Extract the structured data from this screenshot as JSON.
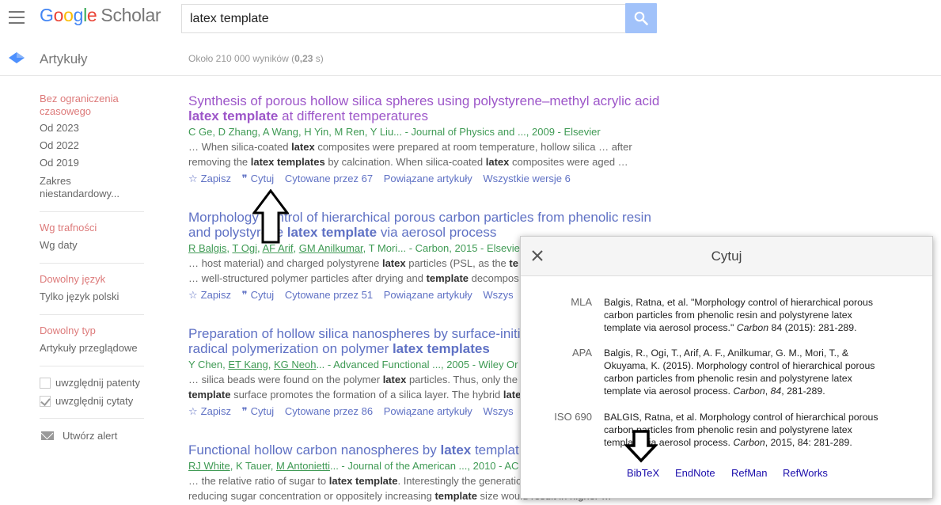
{
  "header": {
    "logo_google": "Google",
    "logo_scholar": "Scholar",
    "search_value": "latex template"
  },
  "subheader": {
    "section_label": "Artykuły",
    "stats_prefix": "Około 210 000 wyników (",
    "stats_time": "0,23",
    "stats_suffix": " s)"
  },
  "sidebar": {
    "time_any": "Bez ograniczenia czasowego",
    "since_2023": "Od 2023",
    "since_2022": "Od 2022",
    "since_2019": "Od 2019",
    "custom_range": "Zakres niestandardowy...",
    "sort_relevance": "Wg trafności",
    "sort_date": "Wg daty",
    "lang_any": "Dowolny język",
    "lang_polish": "Tylko język polski",
    "type_any": "Dowolny typ",
    "type_review": "Artykuły przeglądowe",
    "include_patents": "uwzględnij patenty",
    "include_citations": "uwzględnij cytaty",
    "create_alert": "Utwórz alert"
  },
  "results": [
    {
      "title_a": "Synthesis of porous hollow silica spheres using polystyrene–methyl acrylic acid",
      "title_b": "latex template",
      "title_c": " at different temperatures",
      "authors": "C Ge, D Zhang, A Wang, H Yin, M Ren, Y Liu... - Journal of Physics and ..., 2009 - Elsevier",
      "snippet1": "… When silica-coated latex composites were prepared at room temperature, hollow silica … after",
      "snippet2": "removing the latex templates by calcination. When silica-coated latex composites were aged …",
      "save": "Zapisz",
      "cite": "Cytuj",
      "cited_by": "Cytowane przez 67",
      "related": "Powiązane artykuły",
      "versions": "Wszystkie wersje 6"
    },
    {
      "title_a": "Morphology control of hierarchical porous carbon particles from phenolic resin",
      "title_b": "and polystyrene latex template via aerosol process",
      "authors": "R Balgis, T Ogi, AF Arif, GM Anilkumar, T Mori... - Carbon, 2015 - Elsevier",
      "snippet1": "… host material) and charged polystyrene latex particles (PSL, as the te",
      "snippet2": "… well-structured polymer particles after drying and template decompos",
      "save": "Zapisz",
      "cite": "Cytuj",
      "cited_by": "Cytowane przez 51",
      "related": "Powiązane artykuły",
      "versions": "Wszys"
    },
    {
      "title_a": "Preparation of hollow silica nanospheres by surface-initi",
      "title_b": "radical polymerization on polymer latex templates",
      "authors": "Y Chen, ET Kang, KG Neoh... - Advanced Functional ..., 2005 - Wiley Or",
      "snippet1": "… silica beads were found on the polymer latex particles. Thus, only the",
      "snippet2": "template surface promotes the formation of a silica layer. The hybrid late",
      "save": "Zapisz",
      "cite": "Cytuj",
      "cited_by": "Cytowane przez 86",
      "related": "Powiązane artykuły",
      "versions": "Wszys"
    },
    {
      "title_a": "Functional hollow carbon nanospheres by latex templat",
      "authors": "RJ White, K Tauer, M Antonietti... - Journal of the American ..., 2010 - AC",
      "snippet1": "… the relative ratio of sugar to latex template. Interestingly the generatio",
      "snippet2": "reducing sugar concentration or oppositely increasing template size would result in higher …"
    }
  ],
  "cite_dialog": {
    "title": "Cytuj",
    "styles": [
      {
        "name": "MLA"
      },
      {
        "name": "APA"
      },
      {
        "name": "ISO 690"
      }
    ],
    "mla_line1": "Balgis, Ratna, et al. \"Morphology control of hierarchical porous",
    "mla_line2": "carbon particles from phenolic resin and polystyrene latex",
    "mla_line3a": "template via aerosol process.\" ",
    "mla_journal": "Carbon",
    "mla_line3b": " 84 (2015): 281-289.",
    "apa_line1": "Balgis, R., Ogi, T., Arif, A. F., Anilkumar, G. M., Mori, T., &",
    "apa_line2": "Okuyama, K. (2015). Morphology control of hierarchical porous",
    "apa_line3": "carbon particles from phenolic resin and polystyrene latex",
    "apa_line4a": "template via aerosol process. ",
    "apa_journal": "Carbon",
    "apa_sep": ", ",
    "apa_volume": "84",
    "apa_line4b": ", 281-289.",
    "iso_line1": "BALGIS, Ratna, et al. Morphology control of hierarchical porous",
    "iso_line2": "carbon particles from phenolic resin and polystyrene latex",
    "iso_line3a": "template via aerosol process. ",
    "iso_journal": "Carbon",
    "iso_line3b": ", 2015, 84: 281-289.",
    "links": [
      "BibTeX",
      "EndNote",
      "RefMan",
      "RefWorks"
    ]
  }
}
